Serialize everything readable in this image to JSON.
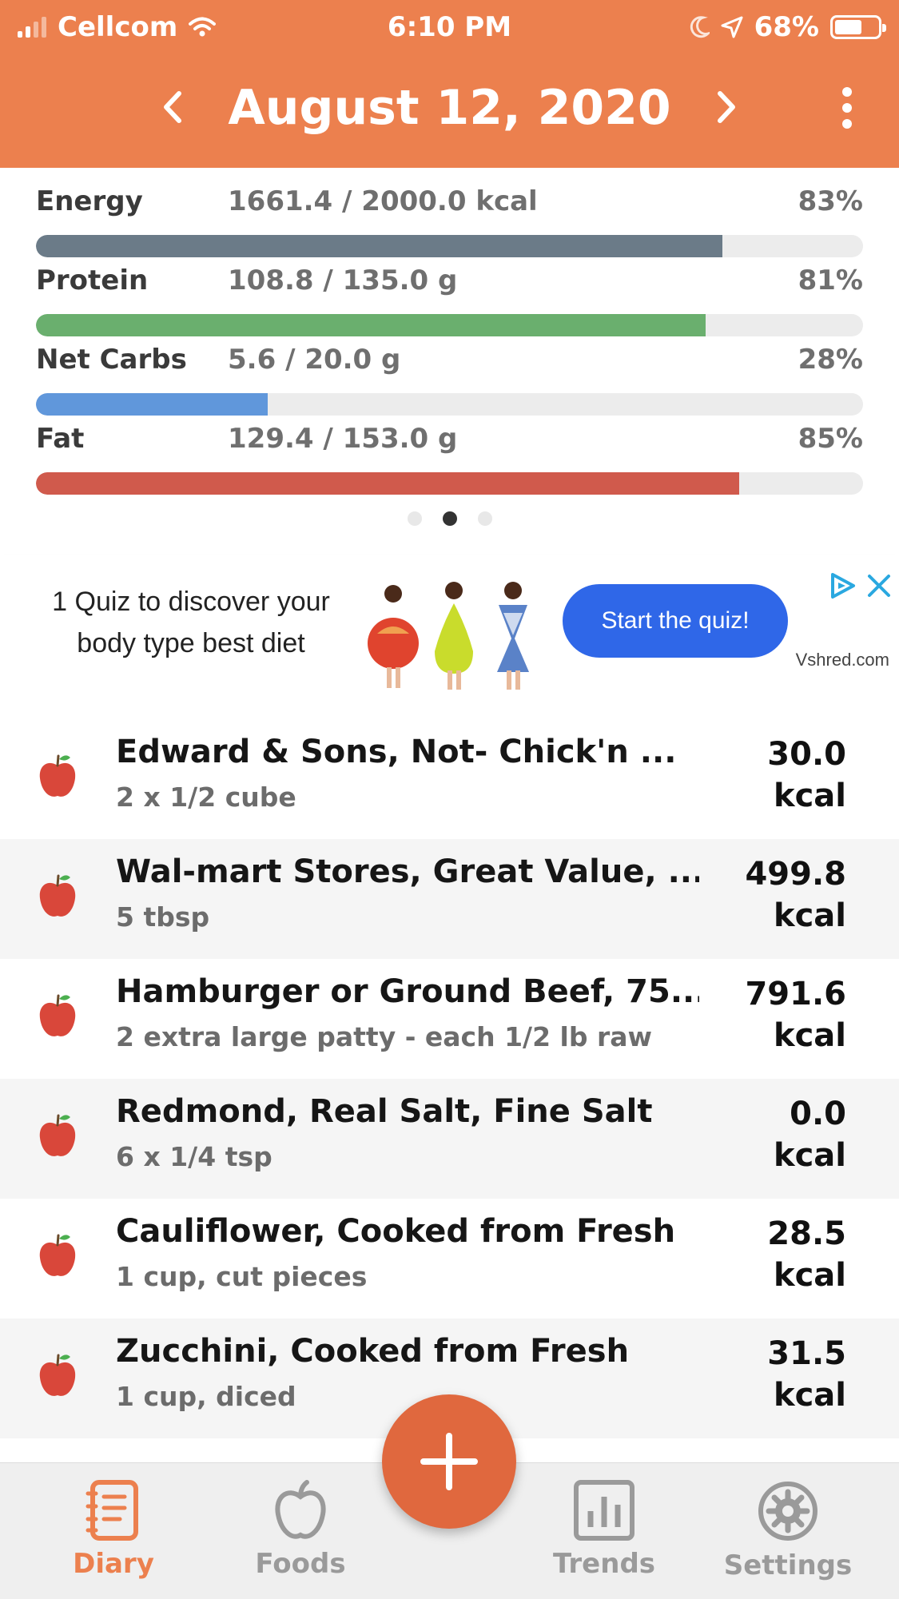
{
  "status_bar": {
    "carrier": "Cellcom",
    "time": "6:10 PM",
    "battery": "68%",
    "battery_level": 0.68
  },
  "header": {
    "date": "August 12, 2020",
    "icons": [
      "chevron-left-icon",
      "chevron-right-icon",
      "more-vertical-icon"
    ]
  },
  "macros": [
    {
      "name": "Energy",
      "value": "1661.4 / 2000.0 kcal",
      "percent": "83%",
      "fraction": 0.83,
      "color": "#6b7b88"
    },
    {
      "name": "Protein",
      "value": "108.8 / 135.0 g",
      "percent": "81%",
      "fraction": 0.81,
      "color": "#6aaf6e"
    },
    {
      "name": "Net Carbs",
      "value": "5.6 / 20.0 g",
      "percent": "28%",
      "fraction": 0.28,
      "color": "#6097db"
    },
    {
      "name": "Fat",
      "value": "129.4 / 153.0 g",
      "percent": "85%",
      "fraction": 0.85,
      "color": "#d05a4c"
    }
  ],
  "pager": {
    "count": 3,
    "active": 1
  },
  "ad": {
    "text": "1 Quiz to discover your body type best diet",
    "button": "Start the quiz!",
    "domain": "Vshred.com"
  },
  "foods": [
    {
      "name": "Edward & Sons, Not- Chick'n ...",
      "serving": "2 x 1/2 cube",
      "kcal_value": "30.0",
      "kcal_unit": "kcal"
    },
    {
      "name": "Wal-mart Stores, Great Value, ...",
      "serving": "5 tbsp",
      "kcal_value": "499.8",
      "kcal_unit": "kcal"
    },
    {
      "name": "Hamburger or Ground Beef, 75...",
      "serving": "2 extra large patty - each 1/2 lb raw",
      "kcal_value": "791.6",
      "kcal_unit": "kcal"
    },
    {
      "name": "Redmond, Real Salt, Fine Salt",
      "serving": "6 x 1/4 tsp",
      "kcal_value": "0.0",
      "kcal_unit": "kcal"
    },
    {
      "name": "Cauliflower, Cooked from Fresh",
      "serving": "1 cup, cut pieces",
      "kcal_value": "28.5",
      "kcal_unit": "kcal"
    },
    {
      "name": "Zucchini, Cooked from Fresh",
      "serving": "1 cup, diced",
      "kcal_value": "31.5",
      "kcal_unit": "kcal"
    }
  ],
  "tabs": {
    "diary": "Diary",
    "foods": "Foods",
    "trends": "Trends",
    "settings": "Settings",
    "active": "diary"
  },
  "colors": {
    "header": "#ec804e",
    "accent": "#e0683e",
    "ad_button": "#2f67e8"
  }
}
